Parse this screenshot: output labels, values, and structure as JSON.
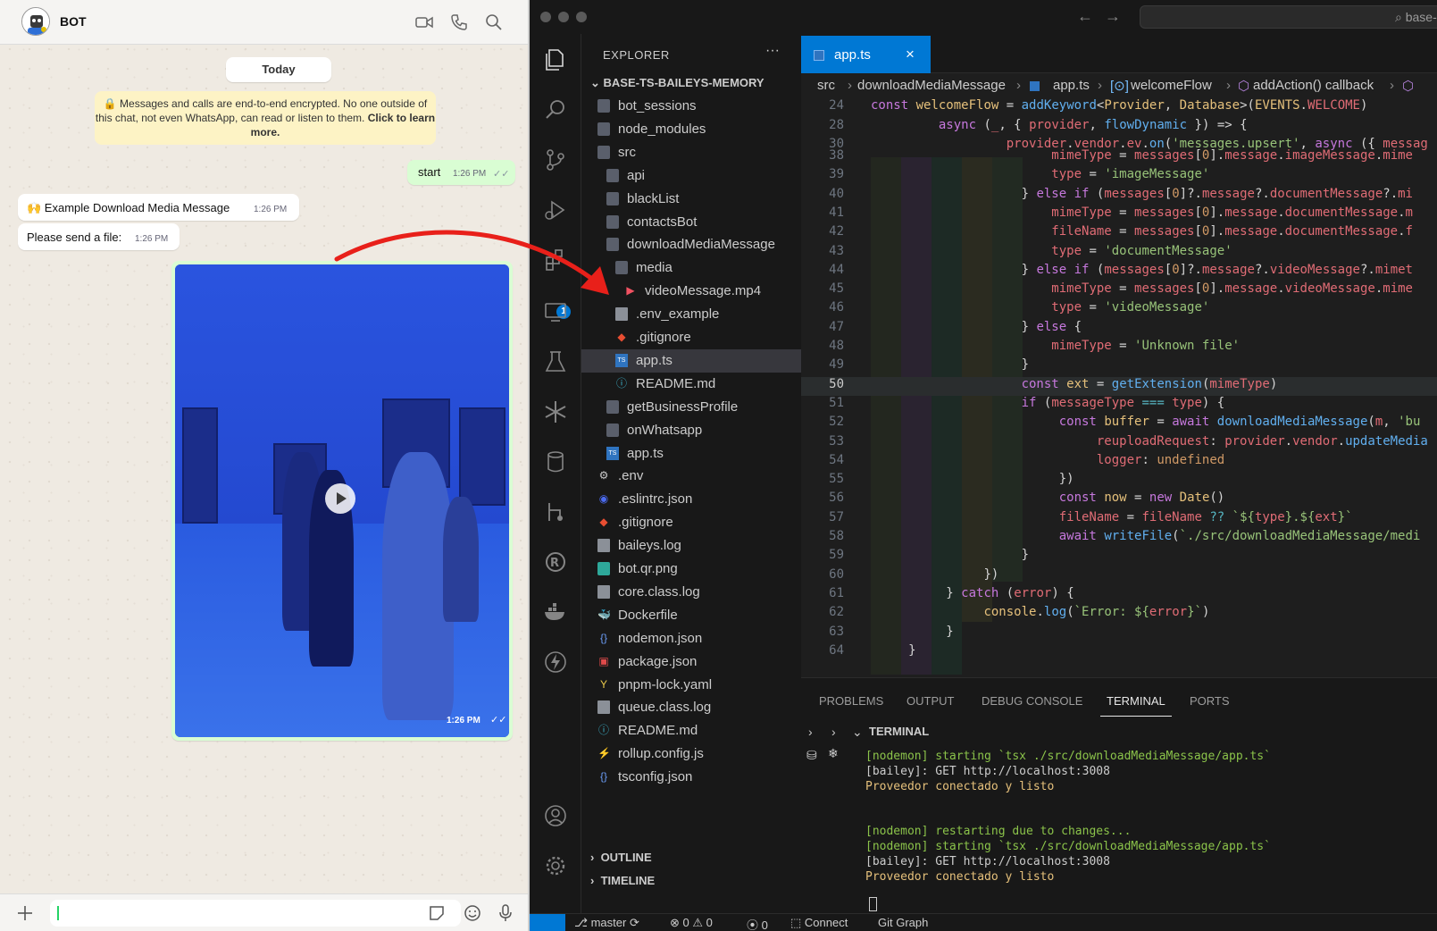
{
  "whatsapp": {
    "contact_name": "BOT",
    "date_chip": "Today",
    "encryption_notice": "🔒 Messages and calls are end-to-end encrypted. No one outside of this chat, not even WhatsApp, can read or listen to them.",
    "encryption_link": "Click to learn more.",
    "messages": [
      {
        "text": "start",
        "time": "1:26 PM"
      },
      {
        "text": "🙌 Example Download Media Message",
        "time": "1:26 PM"
      },
      {
        "text": "Please send a file:",
        "time": "1:26 PM"
      }
    ],
    "video_time": "1:26 PM",
    "read_check": "✓✓"
  },
  "vscode": {
    "search_text": "⌕ base-",
    "explorer_label": "EXPLORER",
    "more": "···",
    "project": "BASE-TS-BAILEYS-MEMORY",
    "tree": [
      {
        "name": "bot_sessions"
      },
      {
        "name": "node_modules"
      },
      {
        "name": "src"
      },
      {
        "name": "api"
      },
      {
        "name": "blackList"
      },
      {
        "name": "contactsBot"
      },
      {
        "name": "downloadMediaMessage"
      },
      {
        "name": "media"
      },
      {
        "name": "videoMessage.mp4"
      },
      {
        "name": ".env_example"
      },
      {
        "name": ".gitignore"
      },
      {
        "name": "app.ts"
      },
      {
        "name": "README.md"
      },
      {
        "name": "getBusinessProfile"
      },
      {
        "name": "onWhatsapp"
      },
      {
        "name": "app.ts"
      },
      {
        "name": ".env"
      },
      {
        "name": ".eslintrc.json"
      },
      {
        "name": ".gitignore"
      },
      {
        "name": "baileys.log"
      },
      {
        "name": "bot.qr.png"
      },
      {
        "name": "core.class.log"
      },
      {
        "name": "Dockerfile"
      },
      {
        "name": "nodemon.json"
      },
      {
        "name": "package.json"
      },
      {
        "name": "pnpm-lock.yaml"
      },
      {
        "name": "queue.class.log"
      },
      {
        "name": "README.md"
      },
      {
        "name": "rollup.config.js"
      },
      {
        "name": "tsconfig.json"
      }
    ],
    "outline": "OUTLINE",
    "timeline": "TIMELINE",
    "tab_label": "app.ts",
    "breadcrumb": [
      "src",
      "downloadMediaMessage",
      "app.ts",
      "welcomeFlow",
      "addAction() callback"
    ],
    "line_numbers": [
      "24",
      "28",
      "30",
      "38",
      "39",
      "40",
      "41",
      "42",
      "43",
      "44",
      "45",
      "46",
      "47",
      "48",
      "49",
      "50",
      "51",
      "52",
      "53",
      "54",
      "55",
      "56",
      "57",
      "58",
      "59",
      "60",
      "61",
      "62",
      "63",
      "64"
    ],
    "panel_tabs": [
      "PROBLEMS",
      "OUTPUT",
      "DEBUG CONSOLE",
      "TERMINAL",
      "PORTS"
    ],
    "terminal_title": "TERMINAL",
    "terminal_lines": [
      "[nodemon] starting `tsx ./src/downloadMediaMessage/app.ts`",
      "[bailey]: GET http://localhost:3008",
      "Proveedor conectado y listo",
      "[nodemon] restarting due to changes...",
      "[nodemon] starting `tsx ./src/downloadMediaMessage/app.ts`",
      "[bailey]: GET http://localhost:3008",
      "Proveedor conectado y listo"
    ],
    "status": {
      "branch": "master",
      "problems": "⊗ 0 ⚠ 0",
      "ports": "0",
      "connect": "Connect",
      "git_graph": "Git Graph"
    },
    "badge": "1"
  }
}
